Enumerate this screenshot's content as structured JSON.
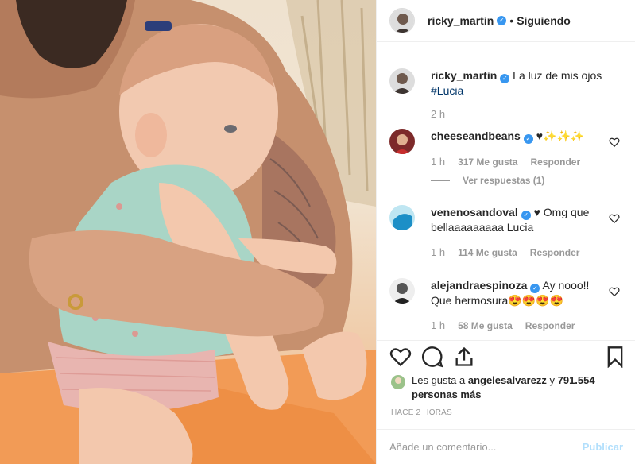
{
  "header": {
    "username": "ricky_martin",
    "separator": "•",
    "follow_label": "Siguiendo"
  },
  "caption": {
    "username": "ricky_martin",
    "text": "La luz de mis ojos",
    "hashtag": "#Lucia",
    "time": "2 h"
  },
  "comments": [
    {
      "username": "cheeseandbeans",
      "text": "♥✨✨✨",
      "time": "1 h",
      "likes": "317 Me gusta",
      "reply": "Responder",
      "view_replies": "Ver respuestas (1)"
    },
    {
      "username": "venenosandoval",
      "text": "♥ Omg que bellaaaaaaaaa Lucia",
      "time": "1 h",
      "likes": "114 Me gusta",
      "reply": "Responder"
    },
    {
      "username": "alejandraespinoza",
      "text": "Ay nooo!! Que hermosura😍😍😍😍",
      "time": "1 h",
      "likes": "58 Me gusta",
      "reply": "Responder"
    }
  ],
  "likes_summary": {
    "prefix": "Les gusta a",
    "user": "angelesalvarezz",
    "connector": "y",
    "others": "791.554 personas más"
  },
  "timestamp": "HACE 2 HORAS",
  "add_comment": {
    "placeholder": "Añade un comentario...",
    "publish_label": "Publicar"
  },
  "icons": [
    "verified-badge-icon",
    "heart-icon",
    "comment-icon",
    "share-icon",
    "bookmark-icon"
  ],
  "colors": {
    "verified": "#3897f0",
    "publish": "#b2dffc",
    "hashtag": "#003569",
    "muted": "#999999"
  }
}
